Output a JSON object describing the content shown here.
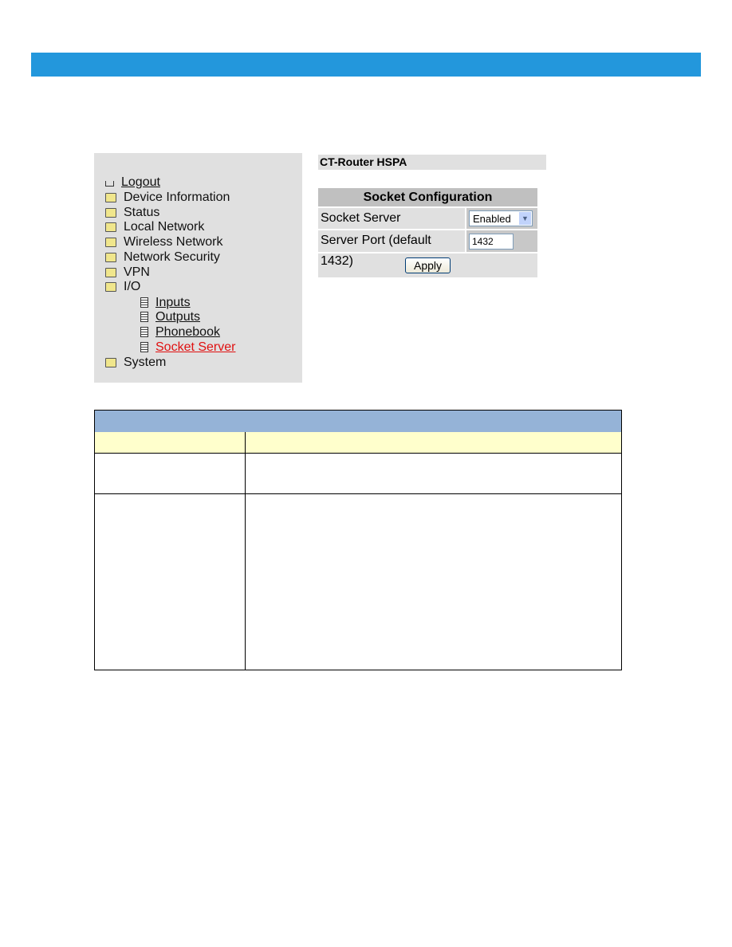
{
  "colors": {
    "header_bar": "#2397dc",
    "table_header": "#95b3d7",
    "table_subheader": "#ffffcc",
    "active_link": "#e01010"
  },
  "sidebar": {
    "items": [
      {
        "label": "Logout",
        "icon": "logout-icon"
      },
      {
        "label": "Device Information",
        "icon": "folder-icon"
      },
      {
        "label": "Status",
        "icon": "folder-icon"
      },
      {
        "label": "Local Network",
        "icon": "folder-icon"
      },
      {
        "label": "Wireless Network",
        "icon": "folder-icon"
      },
      {
        "label": "Network Security",
        "icon": "folder-icon"
      },
      {
        "label": "VPN",
        "icon": "folder-icon"
      },
      {
        "label": "I/O",
        "icon": "folder-icon"
      },
      {
        "label": "Inputs",
        "icon": "document-icon"
      },
      {
        "label": "Outputs",
        "icon": "document-icon"
      },
      {
        "label": "Phonebook",
        "icon": "document-icon"
      },
      {
        "label": "Socket Server",
        "icon": "document-icon",
        "active": true
      },
      {
        "label": "System",
        "icon": "folder-icon"
      }
    ]
  },
  "main": {
    "device_title": "CT-Router HSPA",
    "section_title": "Socket Configuration",
    "socket_server_label": "Socket Server",
    "socket_server_value": "Enabled",
    "port_label": "Server Port (default 1432)",
    "port_value": "1432",
    "apply_label": "Apply"
  }
}
